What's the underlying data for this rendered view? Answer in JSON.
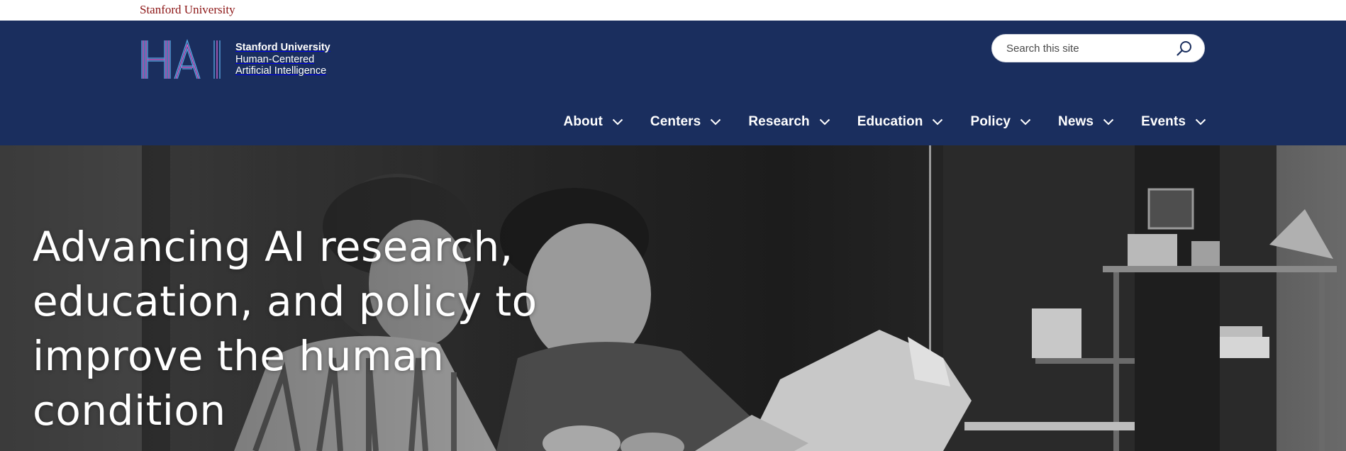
{
  "global_bar": {
    "link_label": "Stanford University"
  },
  "header": {
    "logo": {
      "line1": "Stanford University",
      "line2": "Human-Centered",
      "line3": "Artificial Intelligence"
    },
    "search": {
      "placeholder": "Search this site",
      "icon": "search-icon"
    },
    "nav": [
      {
        "label": "About"
      },
      {
        "label": "Centers"
      },
      {
        "label": "Research"
      },
      {
        "label": "Education"
      },
      {
        "label": "Policy"
      },
      {
        "label": "News"
      },
      {
        "label": "Events"
      }
    ]
  },
  "hero": {
    "heading": "Advancing AI research, education, and policy to improve the human condition"
  },
  "colors": {
    "header_bg": "#1a2e5e",
    "stanford_red": "#8c1515",
    "logo_blue": "#5aa8e6",
    "logo_pink": "#e36ad6"
  }
}
